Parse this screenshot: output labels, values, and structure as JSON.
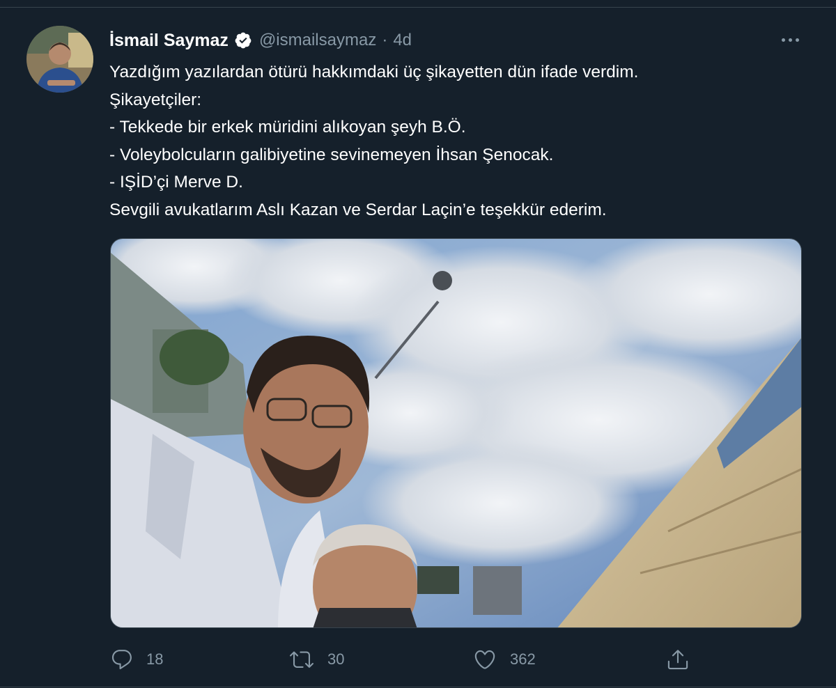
{
  "tweet": {
    "author": {
      "display_name": "İsmail Saymaz",
      "handle": "@ismailsaymaz",
      "verified": true,
      "avatar_icon": "profile-photo"
    },
    "separator": "·",
    "time": "4d",
    "more_icon": "ellipsis-icon",
    "text_lines": [
      "Yazdığım yazılardan ötürü hakkımdaki üç şikayetten dün ifade verdim.",
      "Şikayetçiler:",
      "- Tekkede bir erkek müridini alıkoyan şeyh B.Ö.",
      "- Voleybolcuların galibiyetine sevinemeyen İhsan Şenocak.",
      "- IŞİD’çi Merve D.",
      "Sevgili avukatlarım Aslı Kazan ve Serdar Laçin’e teşekkür ederim."
    ],
    "media": {
      "type": "photo",
      "content": "selfie-two-men-outdoors-cloudy-sky"
    },
    "actions": {
      "reply": {
        "icon": "reply-icon",
        "count": "18"
      },
      "retweet": {
        "icon": "retweet-icon",
        "count": "30"
      },
      "like": {
        "icon": "heart-icon",
        "count": "362"
      },
      "share": {
        "icon": "share-icon"
      }
    }
  },
  "colors": {
    "background": "#15202b",
    "text_primary": "#ffffff",
    "text_secondary": "#8899a6",
    "divider": "#38444d"
  }
}
